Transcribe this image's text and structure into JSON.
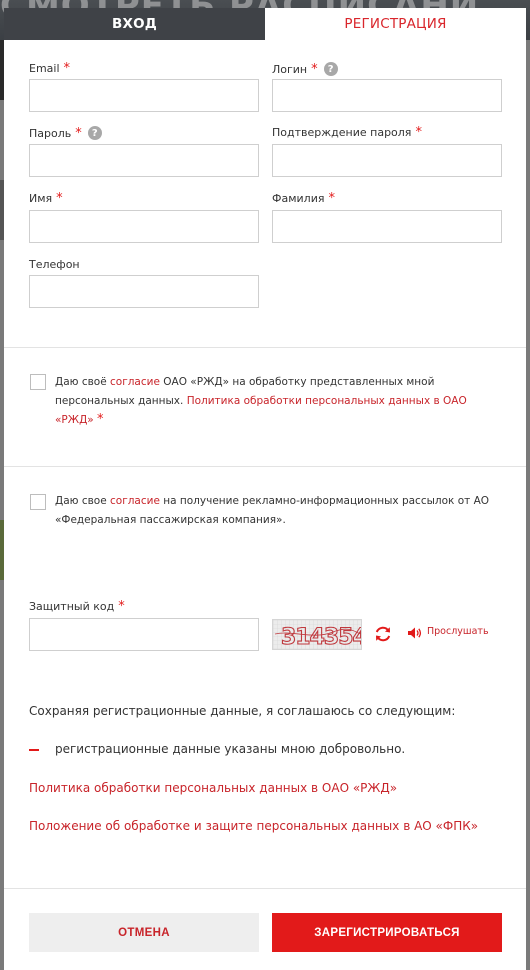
{
  "background": {
    "banner_text": "СМОТРЕТЬ РАСПИСАНИ"
  },
  "tabs": {
    "login": "ВХОД",
    "register": "РЕГИСТРАЦИЯ"
  },
  "form": {
    "email_label": "Email",
    "login_label": "Логин",
    "password_label": "Пароль",
    "password_confirm_label": "Подтверждение пароля",
    "first_name_label": "Имя",
    "last_name_label": "Фамилия",
    "phone_label": "Телефон",
    "required_mark": "*",
    "help_mark": "?"
  },
  "consent1": {
    "prefix": "Даю своё ",
    "link1": "согласие",
    "middle": " ОАО «РЖД» на обработку представленных мной персональных данных. ",
    "link2": "Политика обработки персональных данных в ОАО «РЖД»",
    "required_mark": "*"
  },
  "consent2": {
    "prefix": "Даю свое ",
    "link": "согласие",
    "suffix": " на получение рекламно-информационных рассылок от АО «Федеральная пассажирская компания»."
  },
  "captcha": {
    "label": "Защитный код",
    "required_mark": "*",
    "image_text": "314354",
    "listen_label": "Прослушать"
  },
  "agreement": {
    "title": "Сохраняя регистрационные данные, я соглашаюсь со следующим:",
    "bullet": "регистрационные данные указаны мною добровольно.",
    "policy_link": "Политика обработки персональных данных в ОАО «РЖД»",
    "fpk_link": "Положение об обработке и защите персональных данных в АО «ФПК»"
  },
  "buttons": {
    "cancel": "ОТМЕНА",
    "submit": "ЗАРЕГИСТРИРОВАТЬСЯ"
  },
  "colors": {
    "accent": "#e21a1a",
    "link": "#c8242a",
    "tab_dark": "#3f4247"
  }
}
